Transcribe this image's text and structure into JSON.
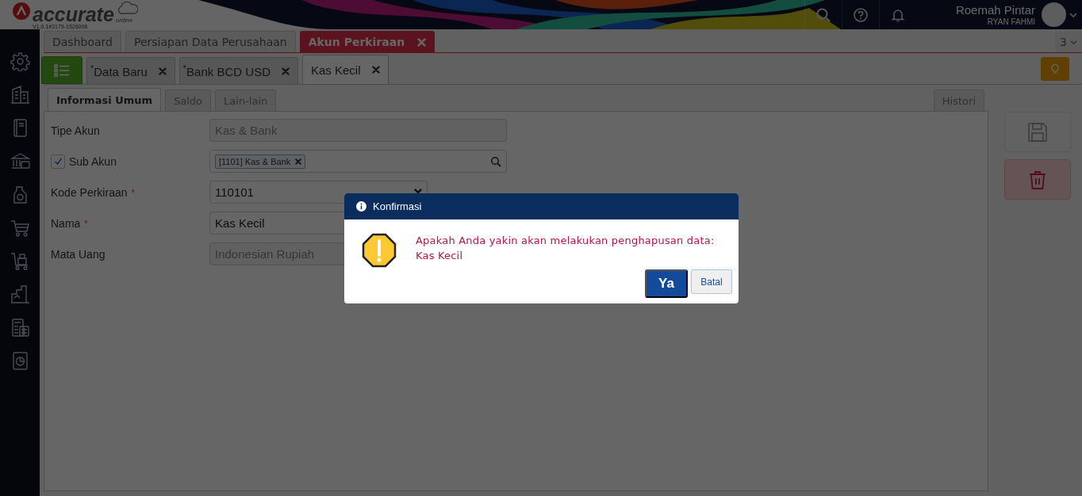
{
  "header": {
    "logo_text": "accurate",
    "logo_sub": "online",
    "version": "V1.0.1#2179-1526006",
    "user_name": "Roemah Pintar",
    "user_sub": "RYAN FAHMI"
  },
  "top_tabs": [
    {
      "label": "Dashboard",
      "selected": false,
      "closable": false
    },
    {
      "label": "Persiapan Data Perusahaan",
      "selected": false,
      "closable": false
    },
    {
      "label": "Akun Perkiraan",
      "selected": true,
      "closable": true
    }
  ],
  "tab_count": "3",
  "doc_tabs": [
    {
      "label": "$^{*}$Data Baru",
      "selected": false
    },
    {
      "label": "$^{*}$Bank BCD USD",
      "selected": false
    },
    {
      "label": "Kas Kecil",
      "selected": true
    }
  ],
  "sub_tabs": [
    {
      "label": "Informasi Umum",
      "selected": true
    },
    {
      "label": "Saldo",
      "selected": false
    },
    {
      "label": "Lain-lain",
      "selected": false
    }
  ],
  "side_tab": "Histori",
  "form": {
    "fields": [
      {
        "kind": "text",
        "label": "Tipe Akun",
        "value": "Kas & Bank",
        "disabled": true
      },
      {
        "kind": "tag",
        "label": "Sub Akun",
        "checked": true,
        "tag": "[1101] Kas & Bank"
      },
      {
        "kind": "text",
        "label": "Kode Perkiraan",
        "required_mark": "*",
        "value": "110101",
        "disabled": false,
        "clearable": true
      },
      {
        "kind": "text",
        "label": "Nama",
        "required_mark": "*",
        "value": "Kas Kecil",
        "disabled": false
      },
      {
        "kind": "text",
        "label": "Mata Uang",
        "value": "Indonesian Rupiah",
        "disabled": true
      }
    ]
  },
  "dialog": {
    "title": "Konfirmasi",
    "message": "Apakah Anda yakin akan melakukan penghapusan data: Kas Kecil",
    "buttons": [
      {
        "label": "Ya",
        "kind": "primary"
      },
      {
        "label": "Batal",
        "kind": "secondary"
      }
    ]
  }
}
